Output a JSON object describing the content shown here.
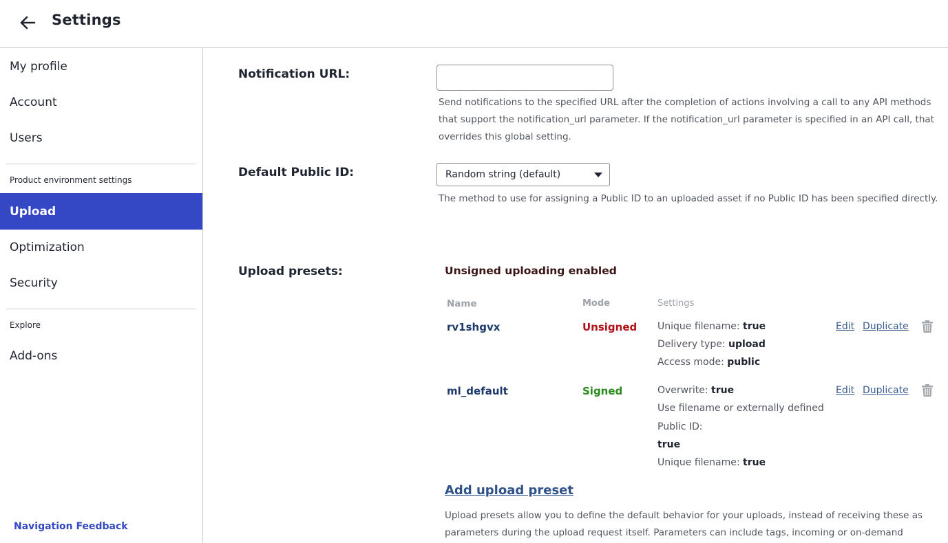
{
  "header": {
    "title": "Settings",
    "back_icon": "arrow-left-icon"
  },
  "sidebar": {
    "items": [
      {
        "label": "My profile"
      },
      {
        "label": "Account"
      },
      {
        "label": "Users"
      }
    ],
    "section_product": "Product environment settings",
    "product_items": [
      {
        "label": "Upload",
        "active": true
      },
      {
        "label": "Optimization"
      },
      {
        "label": "Security"
      }
    ],
    "section_explore": "Explore",
    "explore_items": [
      {
        "label": "Add-ons"
      }
    ],
    "feedback": "Navigation Feedback",
    "active_color": "#3448c5"
  },
  "main": {
    "notification_url": {
      "label": "Notification URL:",
      "value": "",
      "help": "Send notifications to the specified URL after the completion of actions involving a call to any API methods that support the notification_url parameter. If the notification_url parameter is specified in an API call, that overrides this global setting."
    },
    "default_public_id": {
      "label": "Default Public ID:",
      "selected": "Random string (default)",
      "help": "The method to use for assigning a Public ID to an uploaded asset if no Public ID has been specified directly."
    },
    "upload_presets": {
      "label": "Upload presets:",
      "status": "Unsigned uploading enabled",
      "columns": {
        "name": "Name",
        "mode": "Mode",
        "settings": "Settings"
      },
      "rows": [
        {
          "name": "rv1shgvx",
          "mode": "Unsigned",
          "settings": [
            {
              "key": "Unique filename:",
              "value": "true"
            },
            {
              "key": "Delivery type:",
              "value": "upload"
            },
            {
              "key": "Access mode:",
              "value": "public"
            }
          ],
          "edit": "Edit",
          "duplicate": "Duplicate"
        },
        {
          "name": "ml_default",
          "mode": "Signed",
          "settings": [
            {
              "key": "Overwrite:",
              "value": "true"
            },
            {
              "key": "Use filename or externally defined",
              "value": ""
            },
            {
              "key": "Public ID:",
              "value": ""
            },
            {
              "key": "",
              "value": "true"
            },
            {
              "key": "Unique filename:",
              "value": "true"
            }
          ],
          "edit": "Edit",
          "duplicate": "Duplicate"
        }
      ],
      "add_label": "Add upload preset",
      "help": "Upload presets allow you to define the default behavior for your uploads, instead of receiving these as parameters during the upload request itself. Parameters can include tags, incoming or on-demand"
    }
  },
  "colors": {
    "unsigned": "#b4121b",
    "signed": "#2a8a1c",
    "link": "#3b5c8e"
  }
}
